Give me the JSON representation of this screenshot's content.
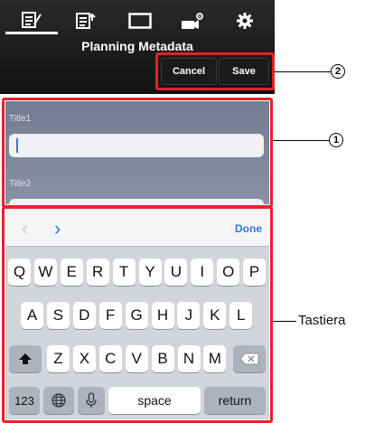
{
  "header": {
    "title": "Planning Metadata",
    "cancel_label": "Cancel",
    "save_label": "Save",
    "tabs": [
      "metadata-edit-icon",
      "metadata-export-icon",
      "screen-icon",
      "camera-settings-icon",
      "gear-icon"
    ]
  },
  "form": {
    "fields": [
      {
        "label": "Title1",
        "value": ""
      },
      {
        "label": "Title2",
        "value": ""
      }
    ]
  },
  "keyboard": {
    "done_label": "Done",
    "row1": [
      "Q",
      "W",
      "E",
      "R",
      "T",
      "Y",
      "U",
      "I",
      "O",
      "P"
    ],
    "row2": [
      "A",
      "S",
      "D",
      "F",
      "G",
      "H",
      "J",
      "K",
      "L"
    ],
    "row3": [
      "Z",
      "X",
      "C",
      "V",
      "B",
      "N",
      "M"
    ],
    "numbers_label": "123",
    "space_label": "space",
    "return_label": "return"
  },
  "annotations": {
    "callout_2": "2",
    "callout_1": "1",
    "keyboard_label": "Tastiera"
  },
  "colors": {
    "highlight": "#e8212c",
    "header": "#1a1a1a",
    "form_bg": "#7f879a",
    "keyboard_bg": "#d2d5db",
    "accent": "#3478d4"
  }
}
